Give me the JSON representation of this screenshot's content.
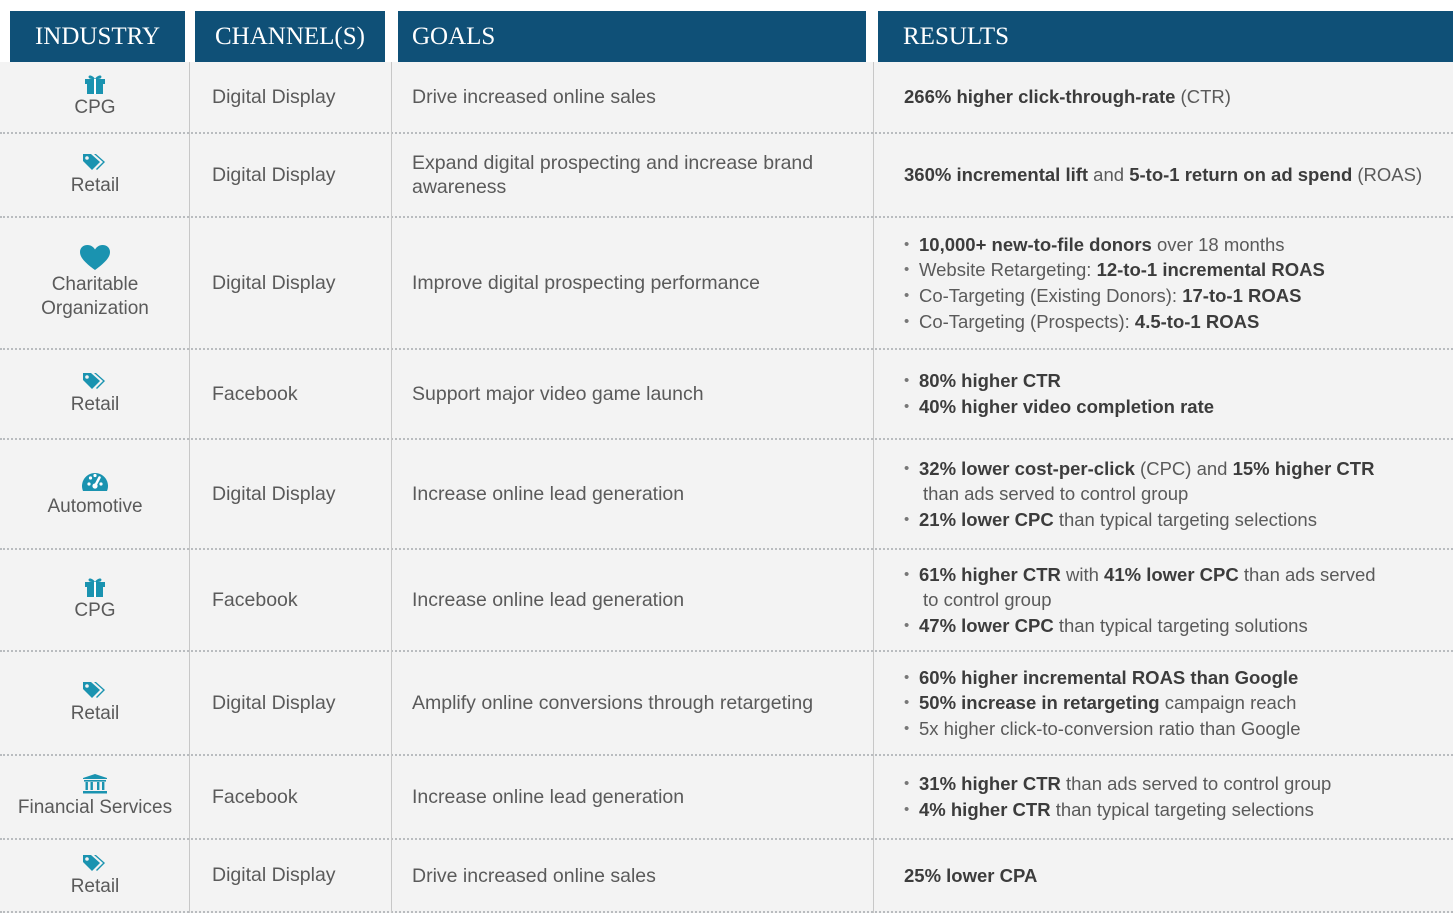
{
  "headers": {
    "industry": "INDUSTRY",
    "channels": "CHANNEL(S)",
    "goals": "GOALS",
    "results": "RESULTS"
  },
  "colors": {
    "header_bg": "#0f5077",
    "icon": "#1a93b0",
    "row_bg": "#f3f3f3"
  },
  "rows": [
    {
      "industry": "CPG",
      "icon": "gift-icon",
      "channel": "Digital Display",
      "goal": "Drive increased online sales",
      "results": [
        {
          "b1": "266% higher click-through-rate",
          "t1": " (CTR)"
        }
      ]
    },
    {
      "industry": "Retail",
      "icon": "tag-icon",
      "channel": "Digital Display",
      "goal": "Expand digital prospecting and increase brand awareness",
      "results": [
        {
          "b1": "360% incremental lift",
          "t1": " and ",
          "b2": "5-to-1 return on ad spend",
          "t2": " (ROAS)"
        }
      ]
    },
    {
      "industry": "Charitable Organization",
      "icon": "heart-icon",
      "channel": "Digital Display",
      "goal": "Improve digital prospecting performance",
      "results": [
        {
          "b1": "10,000+ new-to-file donors",
          "t1": " over 18 months"
        },
        {
          "t0": "Website Retargeting: ",
          "b1": "12-to-1 incremental ROAS"
        },
        {
          "t0": "Co-Targeting (Existing Donors): ",
          "b1": "17-to-1 ROAS"
        },
        {
          "t0": "Co-Targeting (Prospects): ",
          "b1": "4.5-to-1 ROAS"
        }
      ]
    },
    {
      "industry": "Retail",
      "icon": "tag-icon",
      "channel": "Facebook",
      "goal": "Support major video game launch",
      "results": [
        {
          "b1": "80% higher CTR"
        },
        {
          "b1": "40% higher video completion rate"
        }
      ]
    },
    {
      "industry": "Automotive",
      "icon": "speedometer-icon",
      "channel": "Digital Display",
      "goal": "Increase online lead generation",
      "results": [
        {
          "b1": "32% lower cost-per-click",
          "t1": " (CPC) and ",
          "b2": "15% higher CTR",
          "cont": "than ads served to control group"
        },
        {
          "b1": "21% lower CPC",
          "t1": " than typical targeting selections"
        }
      ]
    },
    {
      "industry": "CPG",
      "icon": "gift-icon",
      "channel": "Facebook",
      "goal": "Increase online lead generation",
      "results": [
        {
          "b1": "61% higher CTR",
          "t1": " with ",
          "b2": "41% lower CPC",
          "t2": " than ads served",
          "cont": "to control group"
        },
        {
          "b1": "47% lower CPC",
          "t1": " than typical targeting solutions"
        }
      ]
    },
    {
      "industry": "Retail",
      "icon": "tag-icon",
      "channel": "Digital Display",
      "goal": "Amplify online conversions through retargeting",
      "results": [
        {
          "b1": "60% higher incremental ROAS than Google"
        },
        {
          "b1": "50% increase in retargeting",
          "t1": " campaign reach"
        },
        {
          "t0": "5x higher click-to-conversion ratio than Google"
        }
      ]
    },
    {
      "industry": "Financial Services",
      "icon": "bank-icon",
      "channel": "Facebook",
      "goal": "Increase online lead generation",
      "results": [
        {
          "b1": "31% higher CTR",
          "t1": " than ads served to control group"
        },
        {
          "b1": "4% higher CTR",
          "t1": " than typical targeting selections"
        }
      ]
    },
    {
      "industry": "Retail",
      "icon": "tag-icon",
      "channel": "Digital Display",
      "goal": "Drive increased online sales",
      "results": [
        {
          "b1": "25% lower CPA"
        }
      ]
    }
  ]
}
